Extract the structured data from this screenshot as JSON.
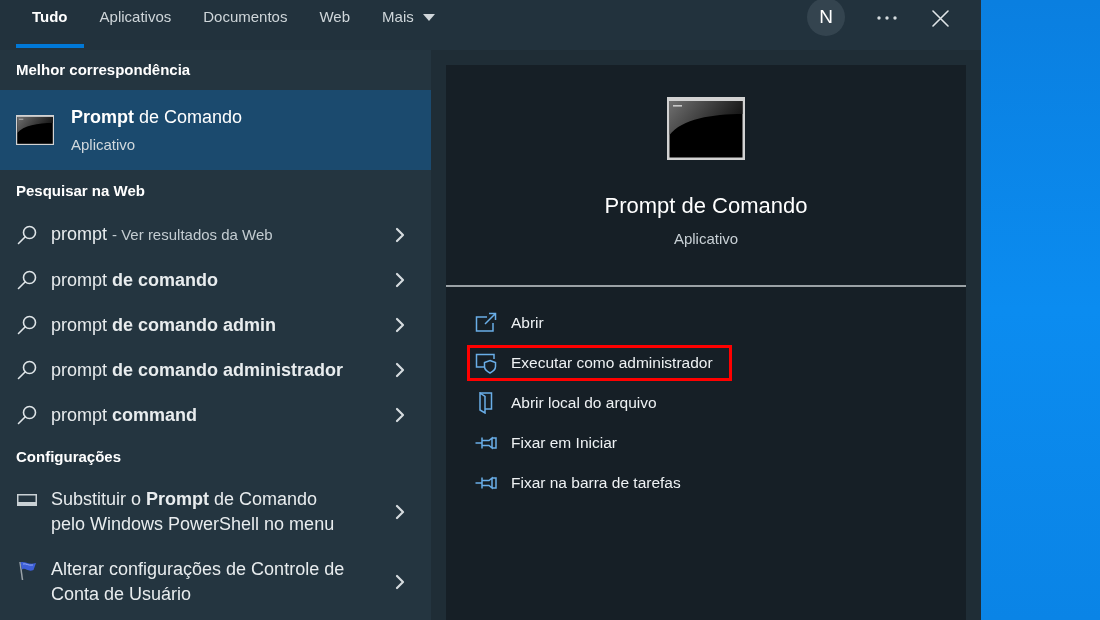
{
  "tabs": [
    {
      "label": "Tudo",
      "selected": true,
      "dropdown": false
    },
    {
      "label": "Aplicativos",
      "selected": false,
      "dropdown": false
    },
    {
      "label": "Documentos",
      "selected": false,
      "dropdown": false
    },
    {
      "label": "Web",
      "selected": false,
      "dropdown": false
    },
    {
      "label": "Mais",
      "selected": false,
      "dropdown": true
    }
  ],
  "account": {
    "initial": "N"
  },
  "results": {
    "best_match": {
      "heading": "Melhor correspondência",
      "title": "**Prompt** de Comando",
      "subtitle": "Aplicativo",
      "selected": true
    },
    "web": {
      "heading": "Pesquisar na Web",
      "items": [
        {
          "query": "prompt",
          "hint": "- Ver resultados da Web"
        },
        {
          "query": "prompt **de comando**"
        },
        {
          "query": "prompt **de comando admin**"
        },
        {
          "query": "prompt **de comando administrador**"
        },
        {
          "query": "prompt **command**"
        }
      ]
    },
    "settings": {
      "heading": "Configurações",
      "items": [
        {
          "kind": "display",
          "text": "Substituir o **Prompt** de Comando pelo Windows PowerShell no menu"
        },
        {
          "kind": "flag",
          "text": "Alterar configurações de Controle de Conta de Usuário"
        }
      ]
    }
  },
  "preview": {
    "title": "Prompt de Comando",
    "subtitle": "Aplicativo",
    "actions": [
      {
        "kind": "open",
        "label": "Abrir",
        "highlighted": false
      },
      {
        "kind": "admin",
        "label": "Executar como administrador",
        "highlighted": true
      },
      {
        "kind": "location",
        "label": "Abrir local do arquivo",
        "highlighted": false
      },
      {
        "kind": "pin",
        "label": "Fixar em Iniciar",
        "highlighted": false
      },
      {
        "kind": "pin",
        "label": "Fixar na barra de tarefas",
        "highlighted": false
      }
    ]
  }
}
